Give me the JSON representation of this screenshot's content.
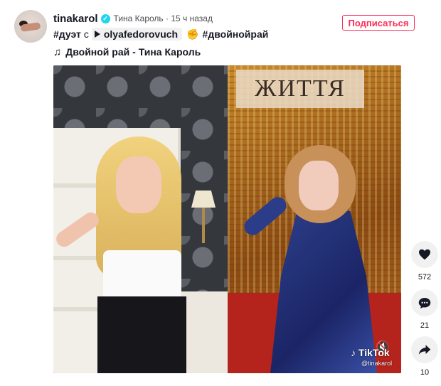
{
  "post": {
    "username": "tinakarol",
    "meta": "Тина Кароль · 15 ч назад",
    "follow_label": "Подписаться",
    "caption": {
      "tag1": "#дуэт",
      "with": "с",
      "mention": "olyafedorovuch",
      "tag2": "#двойнойрай"
    },
    "music": "Двойной рай - Тина Кароль"
  },
  "video": {
    "sign_text": "ЖИТТЯ",
    "watermark": "TikTok",
    "watermark_user": "@tinakarol"
  },
  "actions": {
    "likes": "572",
    "comments": "21",
    "shares": "10"
  },
  "icons": [
    "verified-icon",
    "play-icon",
    "hands-icon",
    "music-note-icon",
    "heart-icon",
    "comment-icon",
    "share-icon",
    "mute-icon",
    "tiktok-logo-icon"
  ],
  "colors": {
    "accent": "#fe2c55",
    "verified": "#20d5ec"
  }
}
